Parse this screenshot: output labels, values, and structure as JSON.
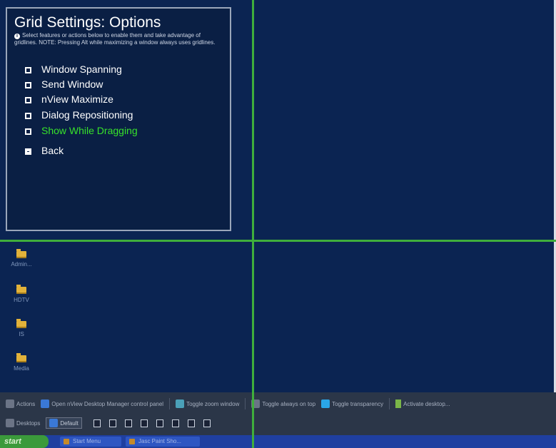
{
  "panel": {
    "title": "Grid Settings: Options",
    "description": "Select features or actions below to enable them and take advantage of gridlines. NOTE: Pressing Alt while maximizing a window always uses gridlines.",
    "options": [
      {
        "label": "Window Spanning",
        "active": false
      },
      {
        "label": "Send Window",
        "active": false
      },
      {
        "label": "nView Maximize",
        "active": false
      },
      {
        "label": "Dialog Repositioning",
        "active": false
      },
      {
        "label": "Show While Dragging",
        "active": true
      }
    ],
    "back_label": "Back"
  },
  "desktop_icons": [
    {
      "label": "Admin..."
    },
    {
      "label": "HDTV"
    },
    {
      "label": "IS"
    },
    {
      "label": "Media"
    }
  ],
  "toolbar": {
    "actions_label": "Actions",
    "open_desktop_manager": "Open nView Desktop Manager control panel",
    "toggle_zoom": "Toggle zoom window",
    "toggle_always_on_top": "Toggle always on top",
    "toggle_transparency": "Toggle transparency",
    "activate_desktop": "Activate desktop...",
    "desktops_label": "Desktops",
    "default_label": "Default",
    "monitor_count": 8
  },
  "taskbar": {
    "start_label": "start",
    "tasks": [
      {
        "label": "Start Menu"
      },
      {
        "label": "Jasc Paint Sho..."
      }
    ]
  },
  "colors": {
    "gridline": "#3fae3c",
    "active_option": "#37e22a",
    "desktop_bg": "#0b2452",
    "panel_bg": "#0a1f44"
  }
}
